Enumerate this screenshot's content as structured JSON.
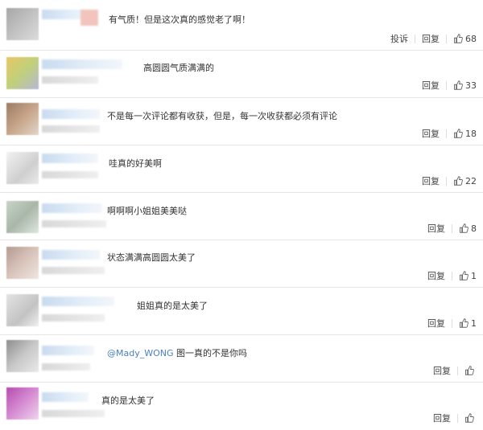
{
  "comments": [
    {
      "text": "有气质！但是这次真的感觉老了啊！",
      "report": "投诉",
      "reply": "回复",
      "likes": "68"
    },
    {
      "text": "高圆圆气质满满的",
      "reply": "回复",
      "likes": "33"
    },
    {
      "text": "不是每一次评论都有收获，但是，每一次收获都必须有评论",
      "reply": "回复",
      "likes": "18"
    },
    {
      "text": "哇真的好美啊",
      "reply": "回复",
      "likes": "22"
    },
    {
      "text": "啊啊啊小姐姐美美哒",
      "reply": "回复",
      "likes": "8"
    },
    {
      "text": "状态满满高圆圆太美了",
      "reply": "回复",
      "likes": "1"
    },
    {
      "text": "姐姐真的是太美了",
      "reply": "回复",
      "likes": "1"
    },
    {
      "mention": "@Mady_WONG",
      "text": " 图一真的不是你吗",
      "reply": "回复"
    },
    {
      "text": "真的是太美了",
      "reply": "回复"
    }
  ]
}
